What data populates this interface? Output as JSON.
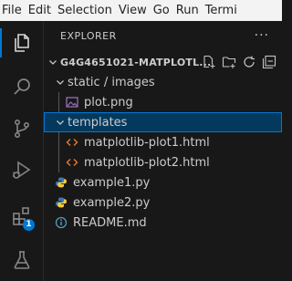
{
  "menubar": {
    "items": [
      "File",
      "Edit",
      "Selection",
      "View",
      "Go",
      "Run",
      "Termi"
    ]
  },
  "activitybar": {
    "items": [
      {
        "name": "explorer-icon",
        "active": true
      },
      {
        "name": "search-icon",
        "active": false
      },
      {
        "name": "source-control-icon",
        "active": false
      },
      {
        "name": "run-debug-icon",
        "active": false
      },
      {
        "name": "extensions-icon",
        "active": false,
        "badge": "1"
      },
      {
        "name": "testing-icon",
        "active": false
      }
    ]
  },
  "sidebar": {
    "title": "EXPLORER",
    "more": "···",
    "root": {
      "label": "G4G4651021-MATPLOTL..."
    },
    "tree": [
      {
        "label": "static / images",
        "type": "folder",
        "expanded": true
      },
      {
        "label": "plot.png",
        "type": "image"
      },
      {
        "label": "templates",
        "type": "folder",
        "expanded": true,
        "selected": true
      },
      {
        "label": "matplotlib-plot1.html",
        "type": "html"
      },
      {
        "label": "matplotlib-plot2.html",
        "type": "html"
      },
      {
        "label": "example1.py",
        "type": "python"
      },
      {
        "label": "example2.py",
        "type": "python"
      },
      {
        "label": "README.md",
        "type": "info"
      }
    ]
  },
  "colors": {
    "accent": "#0078d4",
    "selection": "#04395e",
    "html_icon": "#e37933",
    "python_icon": "#3b77a8",
    "image_icon": "#a074c4",
    "info_icon": "#519aba"
  }
}
